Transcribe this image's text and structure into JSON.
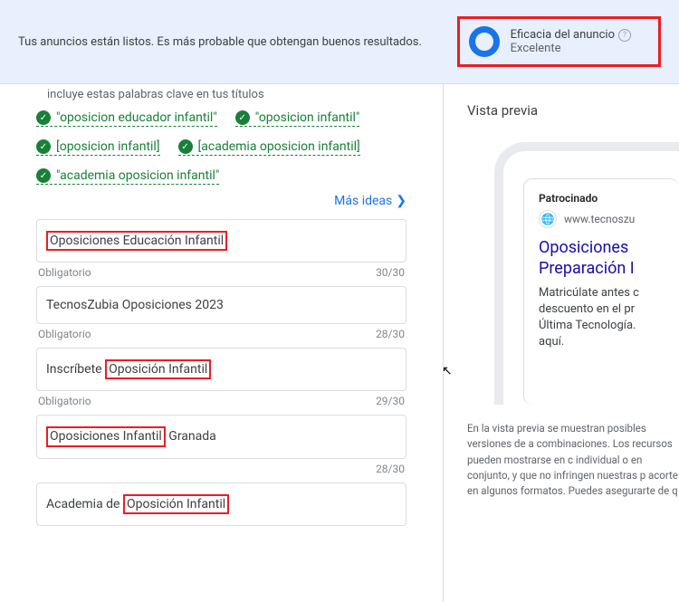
{
  "banner": {
    "message": "Tus anuncios están listos. Es más probable que obtengan buenos resultados.",
    "strength_label": "Eficacia del anuncio",
    "strength_value": "Excelente"
  },
  "left": {
    "intro": "incluye estas palabras clave en tus títulos",
    "keywords": [
      "\"oposicion educador infantil\"",
      "\"oposicion infantil\"",
      "[oposicion infantil]",
      "[academia oposicion infantil]",
      "\"academia oposicion infantil\""
    ],
    "more_ideas": "Más ideas",
    "headlines": [
      {
        "prefix": "",
        "highlight": "Oposiciones Educación Infantil",
        "suffix": "",
        "required": "Obligatorio",
        "count": "30/30"
      },
      {
        "prefix": "TecnosZubia Oposiciones 2023",
        "highlight": "",
        "suffix": "",
        "required": "Obligatorio",
        "count": "28/30"
      },
      {
        "prefix": "Inscríbete ",
        "highlight": "Oposición Infantil",
        "suffix": "",
        "required": "Obligatorio",
        "count": "29/30"
      },
      {
        "prefix": "",
        "highlight": "Oposiciones Infantil",
        "suffix": " Granada",
        "required": "",
        "count": "28/30"
      },
      {
        "prefix": "Academia de ",
        "highlight": "Oposición Infantil",
        "suffix": "",
        "required": "",
        "count": ""
      }
    ]
  },
  "right": {
    "preview_title": "Vista previa",
    "sponsored": "Patrocinado",
    "url": "www.tecnoszu",
    "headline_line1": "Oposiciones",
    "headline_line2": "Preparación I",
    "desc_line1": "Matricúlate antes c",
    "desc_line2": "descuento en el pr",
    "desc_line3": "Última Tecnología.",
    "desc_line4": "aquí.",
    "note": "En la vista previa se muestran posibles versiones de a combinaciones. Los recursos pueden mostrarse en c individual o en conjunto, y que no infringen nuestras p acorte en algunos formatos. Puedes asegurarte de q"
  }
}
